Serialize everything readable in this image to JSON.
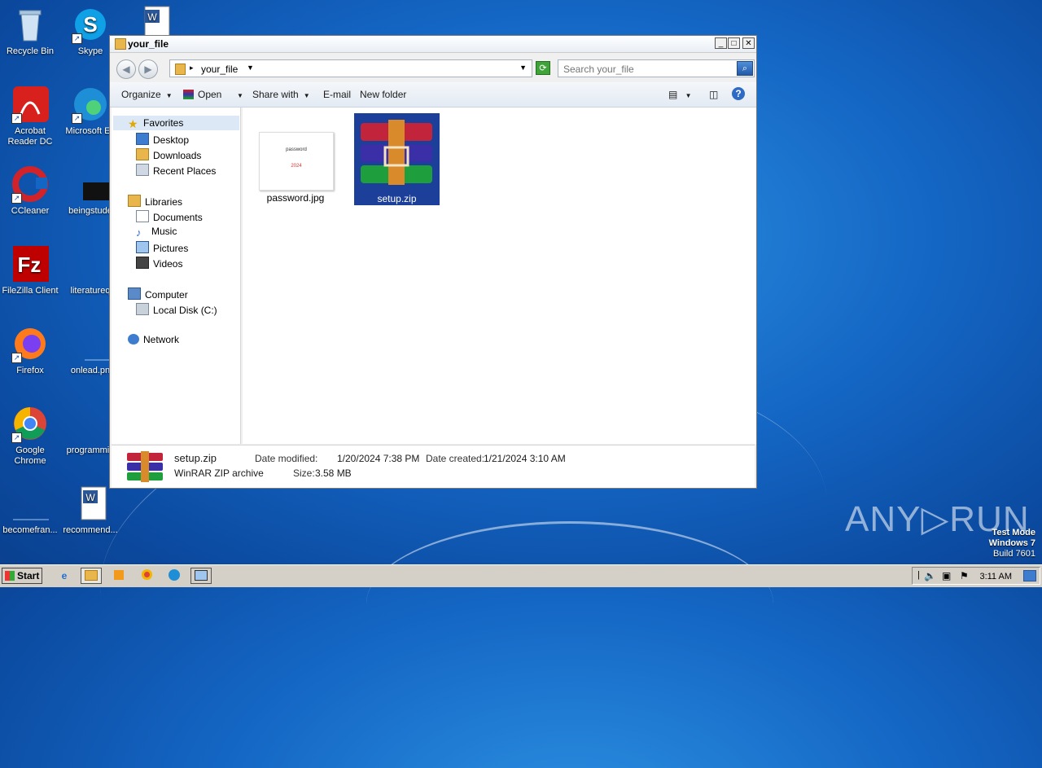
{
  "desktop": {
    "icons": [
      {
        "label": "Recycle Bin",
        "icon": "recycle-bin-icon"
      },
      {
        "label": "Skype",
        "icon": "skype-icon"
      },
      {
        "label": "Acrobat Reader DC",
        "icon": "acrobat-icon"
      },
      {
        "label": "Microsoft Ed",
        "icon": "edge-icon"
      },
      {
        "label": "CCleaner",
        "icon": "ccleaner-icon"
      },
      {
        "label": "beingstude",
        "icon": "file-icon"
      },
      {
        "label": "FileZilla Client",
        "icon": "filezilla-icon"
      },
      {
        "label": "literatureq",
        "icon": "file-icon"
      },
      {
        "label": "Firefox",
        "icon": "firefox-icon"
      },
      {
        "label": "onlead.pn",
        "icon": "image-file-icon"
      },
      {
        "label": "Google Chrome",
        "icon": "chrome-icon"
      },
      {
        "label": "programmin",
        "icon": "file-icon"
      },
      {
        "label": "becomefran...",
        "icon": "file-icon"
      },
      {
        "label": "recommend...",
        "icon": "word-doc-icon"
      }
    ]
  },
  "window": {
    "title": "your_file",
    "address": {
      "path": "your_file",
      "sep": "▸"
    },
    "search": {
      "placeholder": "Search your_file"
    },
    "toolbar": {
      "organize": "Organize",
      "open": "Open",
      "share_with": "Share with",
      "email": "E-mail",
      "new_folder": "New folder"
    },
    "nav": {
      "favorites": "Favorites",
      "desktop": "Desktop",
      "downloads": "Downloads",
      "recent_places": "Recent Places",
      "libraries": "Libraries",
      "documents": "Documents",
      "music": "Music",
      "pictures": "Pictures",
      "videos": "Videos",
      "computer": "Computer",
      "local_disk": "Local Disk (C:)",
      "network": "Network"
    },
    "files": [
      {
        "name": "password.jpg",
        "thumb_line1": "password",
        "thumb_line2": "2024"
      },
      {
        "name": "setup.zip"
      }
    ],
    "details": {
      "name": "setup.zip",
      "type": "WinRAR ZIP archive",
      "modified_label": "Date modified:",
      "modified_value": "1/20/2024 7:38 PM",
      "created_label": "Date created:",
      "created_value": "1/21/2024 3:10 AM",
      "size_label": "Size:",
      "size_value": "3.58 MB"
    }
  },
  "taskbar": {
    "start": "Start",
    "clock": "3:11 AM"
  },
  "watermark": {
    "line1": "Test Mode",
    "line2": "Windows 7",
    "line3": "Build 7601",
    "brand": "ANY▷RUN"
  }
}
